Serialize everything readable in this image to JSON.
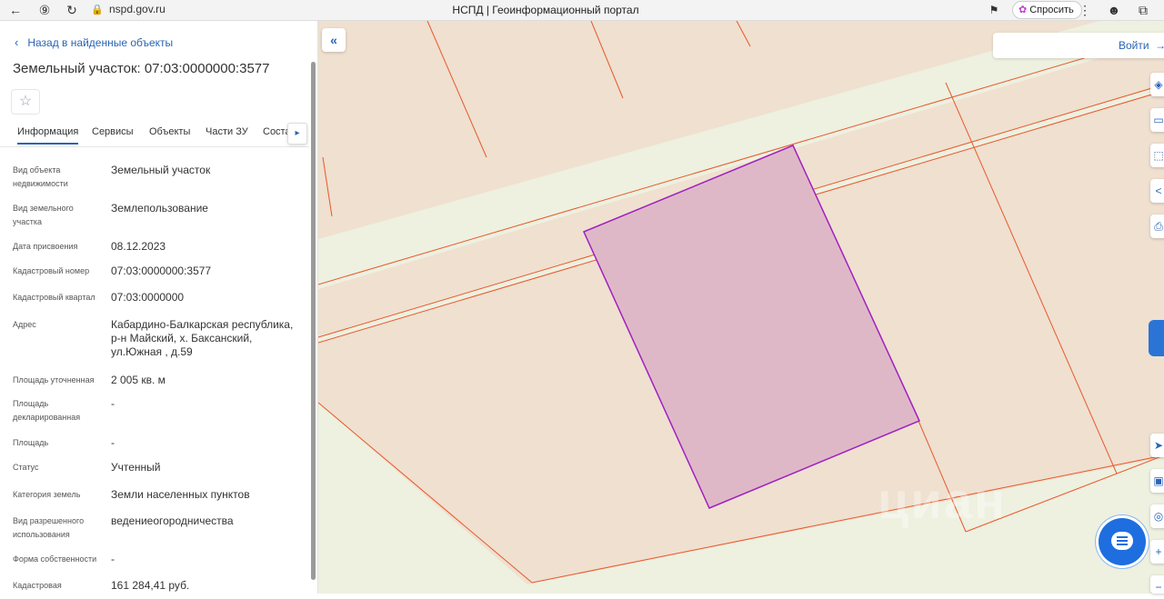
{
  "browser": {
    "url": "nspd.gov.ru",
    "title": "НСПД | Геоинформационный портал",
    "ask_label": "Спросить"
  },
  "panel": {
    "back_label": "Назад в найденные объекты",
    "title": "Земельный участок: 07:03:0000000:3577",
    "tabs": [
      "Информация",
      "Сервисы",
      "Объекты",
      "Части ЗУ",
      "Соста"
    ],
    "fields": [
      {
        "label": "Вид объекта недвижимости",
        "value": "Земельный участок"
      },
      {
        "label": "Вид земельного участка",
        "value": "Землепользование"
      },
      {
        "label": "Дата присвоения",
        "value": "08.12.2023"
      },
      {
        "label": "Кадастровый номер",
        "value": "07:03:0000000:3577"
      },
      {
        "label": "Кадастровый квартал",
        "value": "07:03:0000000"
      },
      {
        "label": "Адрес",
        "value": "Кабардино-Балкарская республика, р-н Майский, х. Баксанский, ул.Южная , д.59"
      },
      {
        "label": "Площадь уточненная",
        "value": "2 005 кв. м"
      },
      {
        "label": "Площадь декларированная",
        "value": "-"
      },
      {
        "label": "Площадь",
        "value": "-"
      },
      {
        "label": "Статус",
        "value": "Учтенный"
      },
      {
        "label": "Категория земель",
        "value": "Земли населенных пунктов"
      },
      {
        "label": "Вид разрешенного использования",
        "value": "ведениеогородничества"
      },
      {
        "label": "Форма собственности",
        "value": "-"
      },
      {
        "label": "Кадастровая",
        "value": "161 284,41 руб."
      }
    ]
  },
  "map": {
    "login_label": "Войти",
    "watermark": "циан",
    "colors": {
      "parcel_fill": "#efe0d0",
      "road": "#eef0e0",
      "boundary": "#e8582a",
      "selected_fill": "#dfb8c8",
      "selected_stroke": "#a020c0",
      "accent": "#2a64b6"
    }
  }
}
